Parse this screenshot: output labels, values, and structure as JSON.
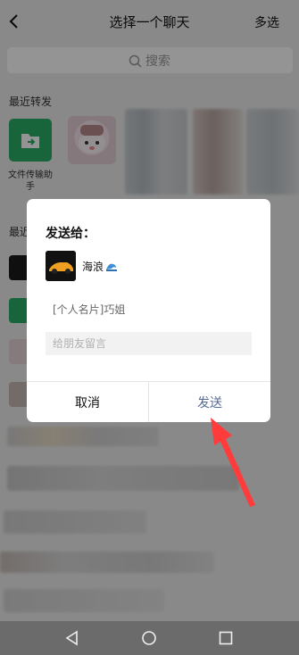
{
  "header": {
    "title": "选择一个聊天",
    "multi_select": "多选"
  },
  "search": {
    "placeholder": "搜索"
  },
  "recent_forward": {
    "section_label": "最近转发",
    "items": [
      {
        "label": "文件传输助手",
        "icon": "folder-icon"
      }
    ]
  },
  "recent_chats": {
    "section_label": "最近"
  },
  "dialog": {
    "title": "发送给：",
    "recipient_name": "海浪",
    "card_text": "[个人名片]巧姐",
    "message_placeholder": "给朋友留言",
    "cancel_label": "取消",
    "send_label": "发送"
  },
  "colors": {
    "accent_green": "#2aae67",
    "send_blue": "#576b95",
    "annotation_red": "#ff3b3b"
  }
}
